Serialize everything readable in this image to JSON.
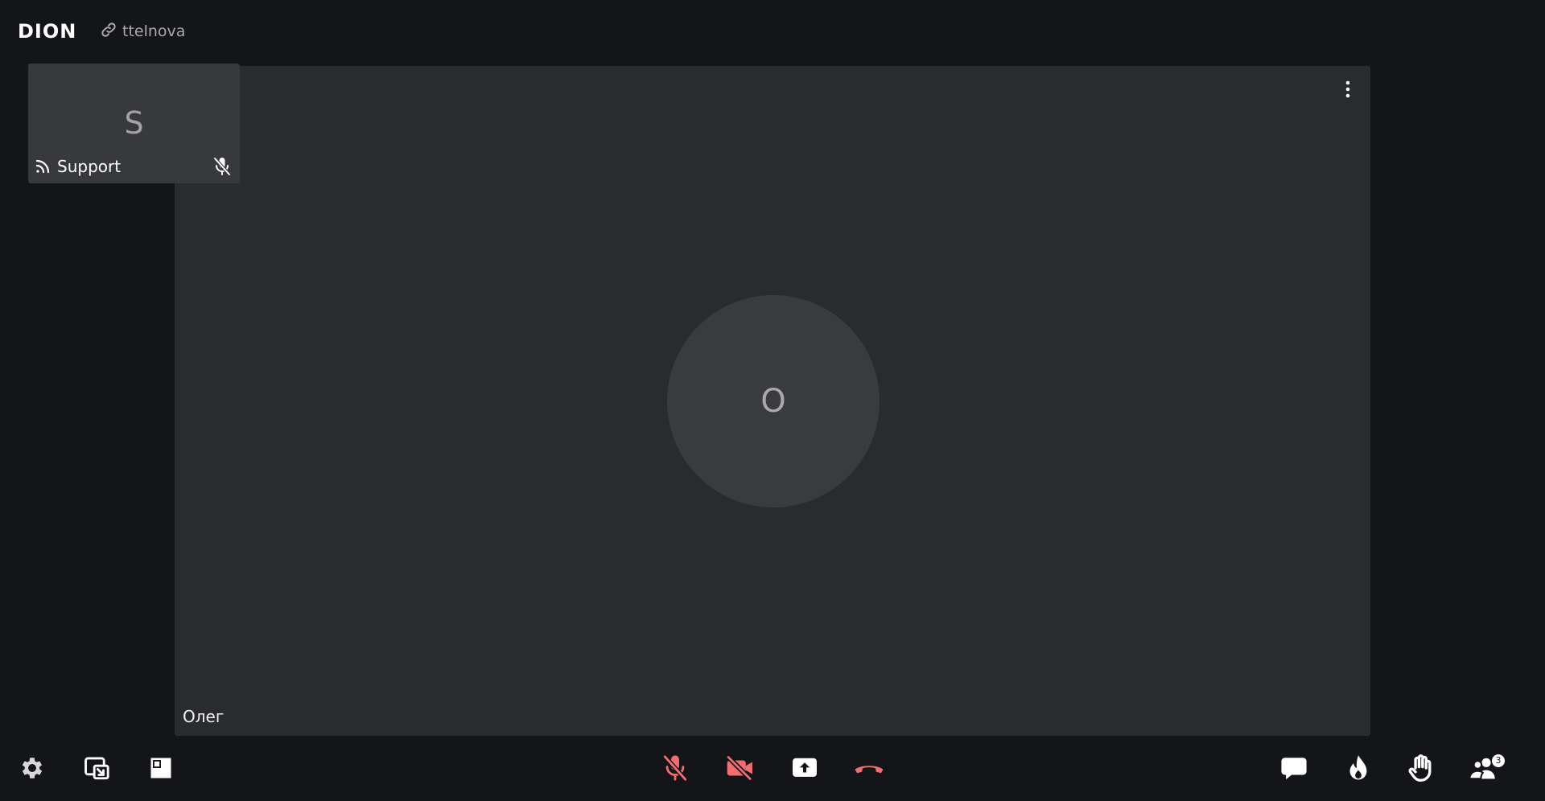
{
  "header": {
    "logo_text": "DION",
    "room_link_text": "ttelnova",
    "link_icon": "link-icon"
  },
  "main_participant": {
    "initial": "O",
    "name": "Олег",
    "menu_icon": "more-vertical-icon"
  },
  "thumbnail_participant": {
    "initial": "S",
    "name": "Support",
    "stream_icon": "broadcast-icon",
    "mic_icon": "mic-off-icon"
  },
  "toolbar": {
    "left": [
      {
        "name": "settings",
        "icon": "gear-icon"
      },
      {
        "name": "picture-in-picture",
        "icon": "pip-icon"
      },
      {
        "name": "layout",
        "icon": "layout-icon"
      }
    ],
    "center": [
      {
        "name": "microphone",
        "icon": "mic-off-icon",
        "state": "off"
      },
      {
        "name": "camera",
        "icon": "camera-off-icon",
        "state": "off"
      },
      {
        "name": "share-screen",
        "icon": "screen-share-icon"
      },
      {
        "name": "hang-up",
        "icon": "phone-hangup-icon"
      }
    ],
    "right": [
      {
        "name": "chat",
        "icon": "chat-icon"
      },
      {
        "name": "reactions",
        "icon": "flame-icon"
      },
      {
        "name": "raise-hand",
        "icon": "hand-icon"
      },
      {
        "name": "participants",
        "icon": "participants-icon",
        "badge": "3"
      }
    ]
  },
  "colors": {
    "background": "#141518",
    "tile": "#2a2b2f",
    "thumb_tile": "#38393d",
    "avatar": "#3a3b3f",
    "danger": "#f26d6d",
    "icon": "#ffffff"
  }
}
